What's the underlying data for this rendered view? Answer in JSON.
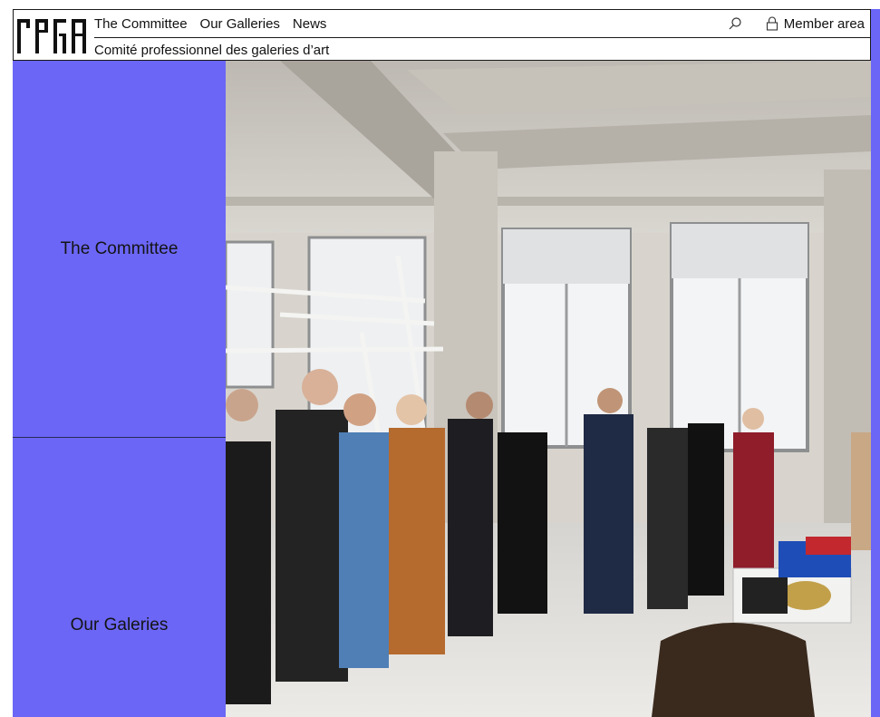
{
  "header": {
    "logo_text": "CPGA",
    "nav": [
      {
        "label": "The Committee"
      },
      {
        "label": "Our Galleries"
      },
      {
        "label": "News"
      }
    ],
    "member_label": "Member area",
    "subtitle": "Comité professionnel des galeries d’art"
  },
  "panels": {
    "committee_label": "The Committee",
    "galleries_label": "Our Galeries"
  },
  "icons": {
    "search": "search-icon",
    "member": "lock-icon"
  },
  "colors": {
    "accent": "#6b66f5",
    "text": "#111111"
  }
}
